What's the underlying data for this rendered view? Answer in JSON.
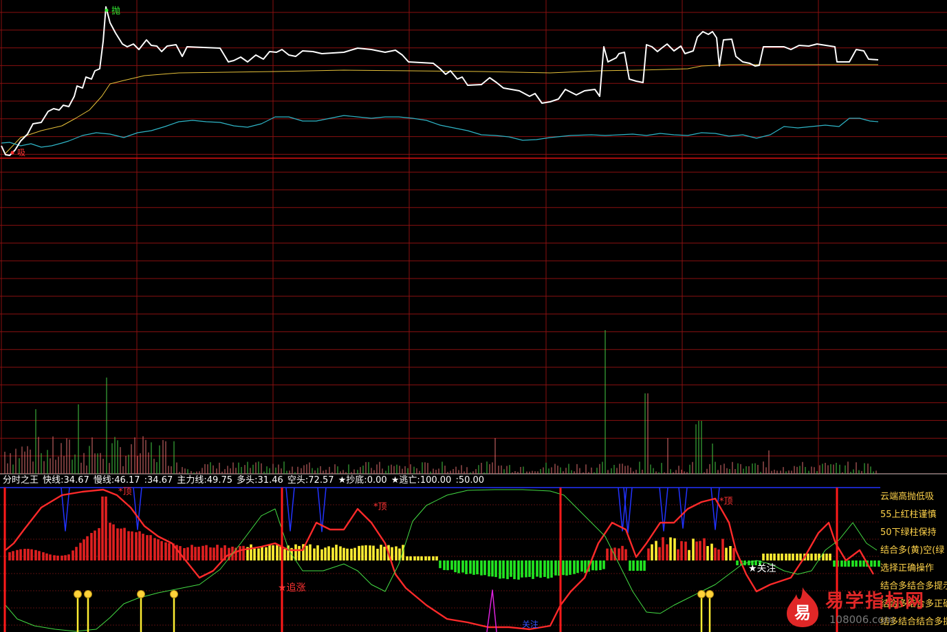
{
  "window": {
    "title": "分时之王"
  },
  "colors": {
    "background": "#000000",
    "grid": "#8a1010",
    "price_line": "#ffffff",
    "avg_line": "#e8c23a",
    "cyan_line": "#2fb6c8",
    "red_bar": "#e02020",
    "green_bar": "#22e622",
    "yellow_bar": "#ffee33",
    "blue_line": "#2233ff",
    "accent_red": "#ff2020"
  },
  "price_panel": {
    "sell_marker": "抛",
    "buy_marker": "吸"
  },
  "indicator_legend": {
    "name": "分时之王",
    "fast_line": "快线:34.67",
    "slow_line": "慢线:46.17",
    "unnamed": ":34.67",
    "main_force": "主力线:49.75",
    "bull": "多头:31.46",
    "bear": "空头:72.57",
    "bottom_star": "★抄底:0.00",
    "escape_star": "★逃亡:100.00",
    "level": ":50.00"
  },
  "indicator_marks": {
    "top1": "*顶",
    "top2": "*顶",
    "top3": "*顶",
    "chase": "★追涨",
    "watch": "★关注",
    "follow": "关注"
  },
  "notes": [
    "云端高抛低吸",
    "55上红柱谨慎",
    "50下绿柱保持",
    "结合多(黄)空(绿",
    "选择正确操作",
    "结合多结合多提示",
    "结合多结合多正确操作",
    "结多结合结合多提示"
  ],
  "watermark": {
    "logo_char": "易",
    "site_name": "易学指标网",
    "url": "108006.com"
  }
}
